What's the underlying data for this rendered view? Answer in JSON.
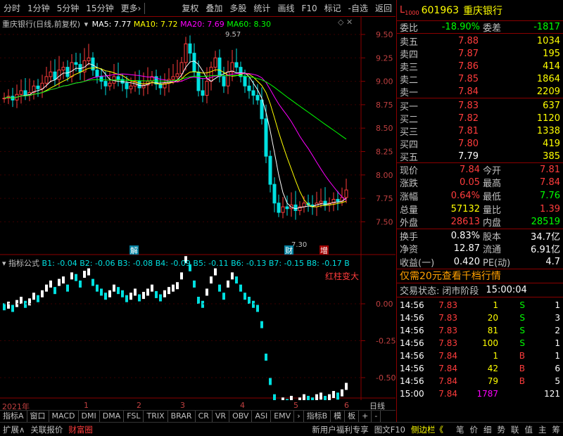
{
  "toolbar": {
    "left": [
      "分时",
      "1分钟",
      "5分钟",
      "15分钟",
      "更多›"
    ],
    "right": [
      "复权",
      "叠加",
      "多股",
      "统计",
      "画线",
      "F10",
      "标记",
      "-自选",
      "返回"
    ]
  },
  "main_legend": {
    "name": "重庆银行(日线,前复权)",
    "ma5": "MA5: 7.77",
    "ma10": "MA10: 7.72",
    "ma20": "MA20: 7.69",
    "ma60": "MA60: 8.30"
  },
  "price_axis": [
    "9.50",
    "9.25",
    "9.00",
    "8.75",
    "8.50",
    "8.25",
    "8.00",
    "7.75",
    "7.50"
  ],
  "annotations": {
    "high": "9.57",
    "low": "7.30",
    "mark1": "解",
    "mark2": "财",
    "mark3": "增"
  },
  "sub_legend": {
    "name": "指标公式",
    "b1": "B1: -0.04",
    "b2": "B2: -0.06",
    "b3": "B3: -0.08",
    "b4": "B4: -0.09",
    "b5": "B5: -0.11",
    "b6": "B6: -0.13",
    "b7": "B7: -0.15",
    "b8": "B8: -0.17",
    "b9": "B",
    "note": "红柱变大"
  },
  "sub_axis": [
    "0.00",
    "-0.25",
    "-0.50"
  ],
  "time_axis": {
    "year": "2021年",
    "months": [
      "1",
      "2",
      "3",
      "4",
      "5",
      "6"
    ],
    "period": "日线"
  },
  "bottom_tabs": [
    "指标A",
    "窗口",
    "MACD",
    "DMI",
    "DMA",
    "FSL",
    "TRIX",
    "BRAR",
    "CR",
    "VR",
    "OBV",
    "ASI",
    "EMV",
    "›",
    "指标B",
    "模",
    "板",
    "+",
    "-"
  ],
  "bottom_bar": [
    "扩展∧",
    "关联报价",
    "财富圈"
  ],
  "bottom_right": [
    "新用户福利专享",
    "图文F10",
    "侧边栏《"
  ],
  "stock": {
    "code": "601963",
    "name": "重庆银行",
    "badge": "L",
    "sub": "1000"
  },
  "weibi": {
    "k1": "委比",
    "v1": "-18.90%",
    "k2": "委差",
    "v2": "-1817"
  },
  "sell": [
    {
      "k": "卖五",
      "p": "7.88",
      "v": "1034"
    },
    {
      "k": "卖四",
      "p": "7.87",
      "v": "195"
    },
    {
      "k": "卖三",
      "p": "7.86",
      "v": "414"
    },
    {
      "k": "卖二",
      "p": "7.85",
      "v": "1864"
    },
    {
      "k": "卖一",
      "p": "7.84",
      "v": "2209"
    }
  ],
  "buy": [
    {
      "k": "买一",
      "p": "7.83",
      "v": "637"
    },
    {
      "k": "买二",
      "p": "7.82",
      "v": "1120"
    },
    {
      "k": "买三",
      "p": "7.81",
      "v": "1338"
    },
    {
      "k": "买四",
      "p": "7.80",
      "v": "419"
    },
    {
      "k": "买五",
      "p": "7.79",
      "v": "385"
    }
  ],
  "quote": [
    {
      "a": "现价",
      "b": "7.84",
      "bc": "red",
      "c": "今开",
      "d": "7.81",
      "dc": "red"
    },
    {
      "a": "涨跌",
      "b": "0.05",
      "bc": "red",
      "c": "最高",
      "d": "7.84",
      "dc": "red"
    },
    {
      "a": "涨幅",
      "b": "0.64%",
      "bc": "red",
      "c": "最低",
      "d": "7.76",
      "dc": "green"
    },
    {
      "a": "总量",
      "b": "57132",
      "bc": "yellow",
      "c": "量比",
      "d": "1.39",
      "dc": "red"
    },
    {
      "a": "外盘",
      "b": "28613",
      "bc": "red",
      "c": "内盘",
      "d": "28519",
      "dc": "green"
    }
  ],
  "stats": [
    {
      "a": "换手",
      "b": "0.83%",
      "c": "股本",
      "d": "34.7亿"
    },
    {
      "a": "净资",
      "b": "12.87",
      "c": "流通",
      "d": "6.91亿"
    },
    {
      "a": "收益(一)",
      "b": "0.420",
      "c": "PE(动)",
      "d": "4.7"
    }
  ],
  "promo": "仅需20元查看千档行情",
  "status": {
    "label": "交易状态:",
    "value": "闭市阶段",
    "time": "15:00:04"
  },
  "ticks": [
    {
      "t": "14:56",
      "p": "7.83",
      "v": "1",
      "s": "S",
      "n": "1"
    },
    {
      "t": "14:56",
      "p": "7.83",
      "v": "20",
      "s": "S",
      "n": "3"
    },
    {
      "t": "14:56",
      "p": "7.83",
      "v": "81",
      "s": "S",
      "n": "2"
    },
    {
      "t": "14:56",
      "p": "7.83",
      "v": "100",
      "s": "S",
      "n": "1"
    },
    {
      "t": "14:56",
      "p": "7.84",
      "v": "1",
      "s": "B",
      "n": "1"
    },
    {
      "t": "14:56",
      "p": "7.84",
      "v": "42",
      "s": "B",
      "n": "6"
    },
    {
      "t": "14:56",
      "p": "7.84",
      "v": "79",
      "s": "B",
      "n": "5"
    },
    {
      "t": "15:00",
      "p": "7.84",
      "v": "1787",
      "s": "",
      "n": "121"
    }
  ],
  "side_tabs": [
    "笔",
    "价",
    "细",
    "势",
    "联",
    "值",
    "主",
    "筹"
  ]
}
